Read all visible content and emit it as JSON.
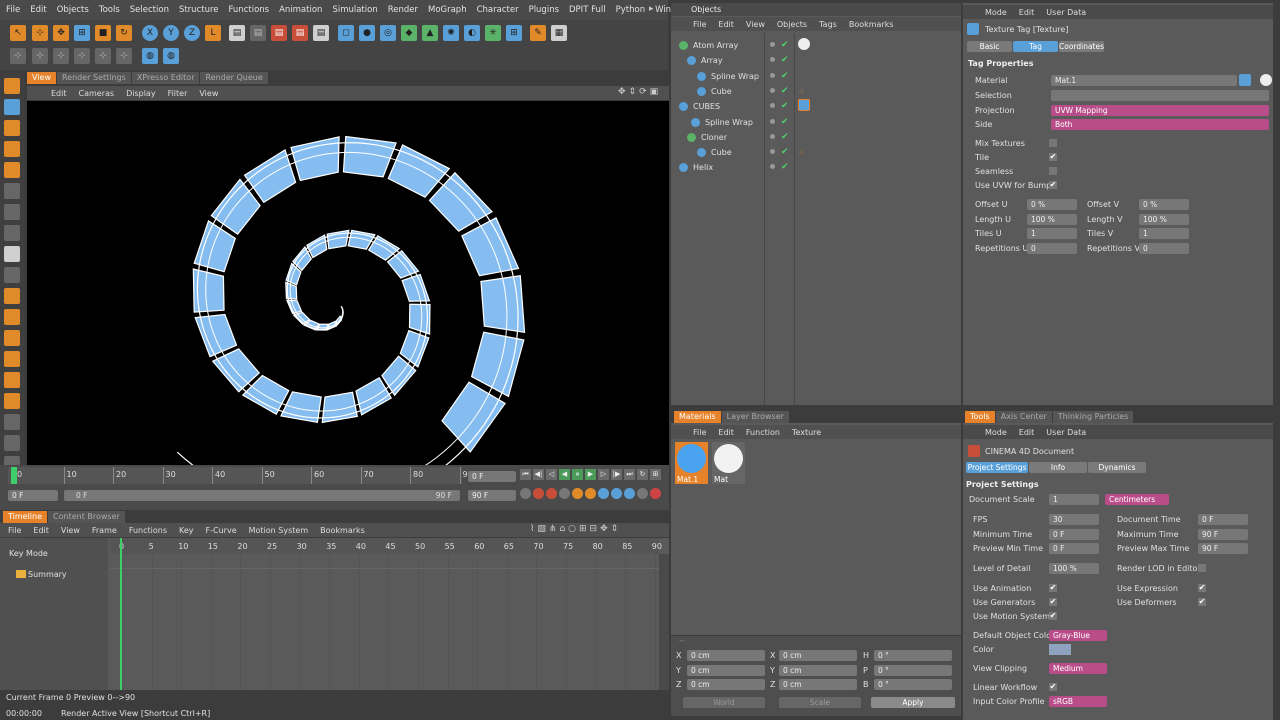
{
  "menubar": [
    "File",
    "Edit",
    "Objects",
    "Tools",
    "Selection",
    "Structure",
    "Functions",
    "Animation",
    "Simulation",
    "Render",
    "MoGraph",
    "Character",
    "Plugins",
    "DPIT Full",
    "Python",
    "Window"
  ],
  "viewport": {
    "tabs": [
      "View",
      "Render Settings",
      "XPresso Editor",
      "Render Queue"
    ],
    "menu": [
      "Edit",
      "Cameras",
      "Display",
      "Filter",
      "View"
    ]
  },
  "powerslider": {
    "ticks": [
      "0",
      "10",
      "20",
      "30",
      "40",
      "50",
      "60",
      "70",
      "80",
      "90"
    ],
    "current": "0 F",
    "start": "0 F",
    "end_inner": "90 F",
    "end": "90 F",
    "slider_start": "0 F"
  },
  "timeline": {
    "tabs": [
      "Timeline",
      "Content Browser"
    ],
    "menu": [
      "File",
      "Edit",
      "View",
      "Frame",
      "Functions",
      "Key",
      "F-Curve",
      "Motion System",
      "Bookmarks"
    ],
    "key_mode": "Key Mode",
    "summary": "Summary",
    "ticks": [
      "0",
      "5",
      "10",
      "15",
      "20",
      "25",
      "30",
      "35",
      "40",
      "45",
      "50",
      "55",
      "60",
      "65",
      "70",
      "75",
      "80",
      "85",
      "90"
    ]
  },
  "status": {
    "frame": "Current Frame  0  Preview  0-->90",
    "time": "00:00:00",
    "message": "Render Active View [Shortcut Ctrl+R]"
  },
  "objects": {
    "title": "Objects",
    "menu": [
      "File",
      "Edit",
      "View",
      "Objects",
      "Tags",
      "Bookmarks"
    ],
    "items": [
      {
        "name": "Atom Array"
      },
      {
        "name": "Array"
      },
      {
        "name": "Spline Wrap"
      },
      {
        "name": "Cube"
      },
      {
        "name": "CUBES"
      },
      {
        "name": "Spline Wrap"
      },
      {
        "name": "Cloner"
      },
      {
        "name": "Cube"
      },
      {
        "name": "Helix"
      }
    ]
  },
  "attributes": {
    "menu": [
      "Mode",
      "Edit",
      "User Data"
    ],
    "title": "Texture Tag [Texture]",
    "tabs": [
      "Basic",
      "Tag",
      "Coordinates"
    ],
    "section": "Tag Properties",
    "material_label": "Material",
    "material": "Mat.1",
    "selection_label": "Selection",
    "projection_label": "Projection",
    "projection": "UVW Mapping",
    "side_label": "Side",
    "side": "Both",
    "mix": "Mix Textures",
    "tile": "Tile",
    "seamless": "Seamless",
    "use_uvw": "Use UVW for Bump",
    "offset_u": "Offset U",
    "offset_u_v": "0 %",
    "offset_v": "Offset V",
    "offset_v_v": "0 %",
    "length_u": "Length U",
    "length_u_v": "100 %",
    "length_v": "Length V",
    "length_v_v": "100 %",
    "tiles_u": "Tiles U",
    "tiles_u_v": "1",
    "tiles_v": "Tiles V",
    "tiles_v_v": "1",
    "rep_u": "Repetitions U",
    "rep_u_v": "0",
    "rep_v": "Repetitions V",
    "rep_v_v": "0"
  },
  "materials": {
    "tabs": [
      "Materials",
      "Layer Browser"
    ],
    "menu": [
      "File",
      "Edit",
      "Function",
      "Texture"
    ],
    "items": [
      {
        "name": "Mat.1"
      },
      {
        "name": "Mat"
      }
    ]
  },
  "coords": {
    "x": "X",
    "y": "Y",
    "z": "Z",
    "h": "H",
    "p": "P",
    "b": "B",
    "pos": "0 cm",
    "rot": "0 °",
    "world": "World",
    "scale": "Scale",
    "apply": "Apply"
  },
  "tools": {
    "tabs": [
      "Tools",
      "Axis Center",
      "Thinking Particles"
    ],
    "menu": [
      "Mode",
      "Edit",
      "User Data"
    ],
    "doc": "CINEMA 4D Document",
    "subtabs": [
      "Project Settings",
      "Info",
      "Dynamics"
    ],
    "section": "Project Settings",
    "doc_scale": "Document Scale",
    "doc_scale_v": "1",
    "units": "Centimeters",
    "fps": "FPS",
    "fps_v": "30",
    "doc_time": "Document Time",
    "doc_time_v": "0 F",
    "min_time": "Minimum Time",
    "min_time_v": "0 F",
    "max_time": "Maximum Time",
    "max_time_v": "90 F",
    "prev_min": "Preview Min Time",
    "prev_min_v": "0 F",
    "prev_max": "Preview Max Time",
    "prev_max_v": "90 F",
    "lod": "Level of Detail",
    "lod_v": "100 %",
    "render_lod": "Render LOD in Editor",
    "use_anim": "Use Animation",
    "use_expr": "Use Expression",
    "use_gen": "Use Generators",
    "use_def": "Use Deformers",
    "use_motion": "Use Motion System",
    "def_color": "Default Object Color",
    "def_color_v": "Gray-Blue",
    "color": "Color",
    "clipping": "View Clipping",
    "clipping_v": "Medium",
    "linear": "Linear Workflow",
    "icp": "Input Color Profile",
    "icp_v": "sRGB"
  },
  "colors": {
    "accent": "#e6832a",
    "blue": "#5aa0d8",
    "magenta": "#b94d8a"
  }
}
